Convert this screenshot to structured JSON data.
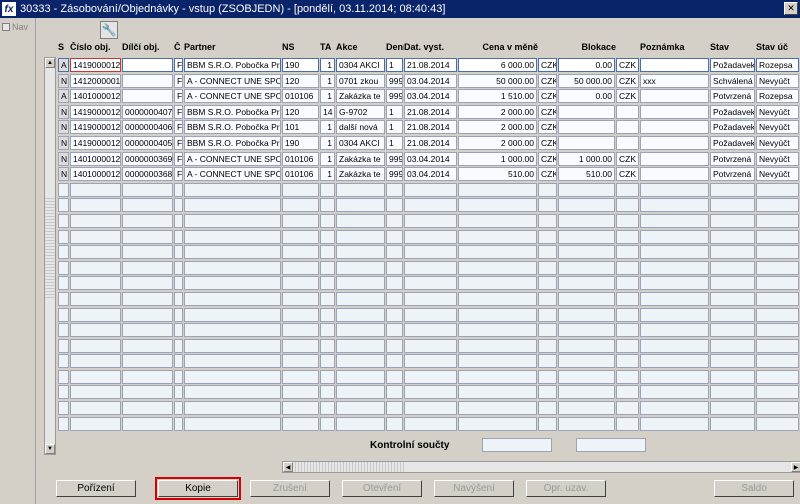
{
  "window": {
    "title": "30333 - Zásobování/Objednávky - vstup (ZSOBJEDN) - [pondělí, 03.11.2014; 08:40:43]",
    "app_icon": "fx",
    "close_glyph": "✕"
  },
  "left_panel": {
    "nav_label": "Nav"
  },
  "toolbar": {
    "tool_icon": "🔧"
  },
  "grid": {
    "headers": [
      "S",
      "Číslo obj.",
      "Dílčí obj.",
      "Č",
      "Partner",
      "NS",
      "TA",
      "Akce",
      "Dení",
      "Dat. vyst.",
      "Cena v měně",
      "",
      "Blokace",
      "",
      "Poznámka",
      "Stav",
      "Stav úč"
    ],
    "rows": [
      [
        "A",
        "1419000012",
        "",
        "F",
        "BBM S.R.O. Pobočka Pra",
        "190",
        "1",
        "0304 AKCI",
        "1",
        "21.08.2014",
        "6 000.00",
        "CZK",
        "0.00",
        "CZK",
        "",
        "Požadavek",
        "Rozepsa"
      ],
      [
        "N",
        "1412000001",
        "",
        "F",
        "A - CONNECT UNE SPOL",
        "120",
        "1",
        "0701 zkou",
        "9999",
        "03.04.2014",
        "50 000.00",
        "CZK",
        "50 000.00",
        "CZK",
        "xxx",
        "Schválená",
        "Nevyúčt"
      ],
      [
        "A",
        "1401000012",
        "",
        "F",
        "A - CONNECT UNE SPOL",
        "010106",
        "1",
        "Zakázka te",
        "9999",
        "03.04.2014",
        "1 510.00",
        "CZK",
        "0.00",
        "CZK",
        "",
        "Potvrzená",
        "Rozepsa"
      ],
      [
        "N",
        "1419000012",
        "0000000407",
        "F",
        "BBM S.R.O. Pobočka Pra",
        "120",
        "14",
        "G-9702",
        "1",
        "21.08.2014",
        "2 000.00",
        "CZK",
        "",
        "",
        "",
        "Požadavek",
        "Nevyúčt"
      ],
      [
        "N",
        "1419000012",
        "0000000406",
        "F",
        "BBM S.R.O. Pobočka Pra",
        "101",
        "1",
        "další nová",
        "1",
        "21.08.2014",
        "2 000.00",
        "CZK",
        "",
        "",
        "",
        "Požadavek",
        "Nevyúčt"
      ],
      [
        "N",
        "1419000012",
        "0000000405",
        "F",
        "BBM S.R.O. Pobočka Pra",
        "190",
        "1",
        "0304 AKCI",
        "1",
        "21.08.2014",
        "2 000.00",
        "CZK",
        "",
        "",
        "",
        "Požadavek",
        "Nevyúčt"
      ],
      [
        "N",
        "1401000012",
        "0000000369",
        "F",
        "A - CONNECT UNE SPOL",
        "010106",
        "1",
        "Zakázka te",
        "9999",
        "03.04.2014",
        "1 000.00",
        "CZK",
        "1 000.00",
        "CZK",
        "",
        "Potvrzená",
        "Nevyúčt"
      ],
      [
        "N",
        "1401000012",
        "0000000368",
        "F",
        "A - CONNECT UNE SPOL",
        "010106",
        "1",
        "Zakázka te",
        "9999",
        "03.04.2014",
        "510.00",
        "CZK",
        "510.00",
        "CZK",
        "",
        "Potvrzená",
        "Nevyúčt"
      ]
    ],
    "empty_row_count": 16
  },
  "summary": {
    "label": "Kontrolní součty"
  },
  "buttons": [
    {
      "label": "Pořízení",
      "enabled": true
    },
    {
      "label": "Kopie",
      "enabled": true
    },
    {
      "label": "Zrušení",
      "enabled": false
    },
    {
      "label": "Otevření",
      "enabled": false
    },
    {
      "label": "Navýšení",
      "enabled": false
    },
    {
      "label": "Opr. uzav.",
      "enabled": false
    },
    {
      "label": "Saldo",
      "enabled": false
    }
  ]
}
